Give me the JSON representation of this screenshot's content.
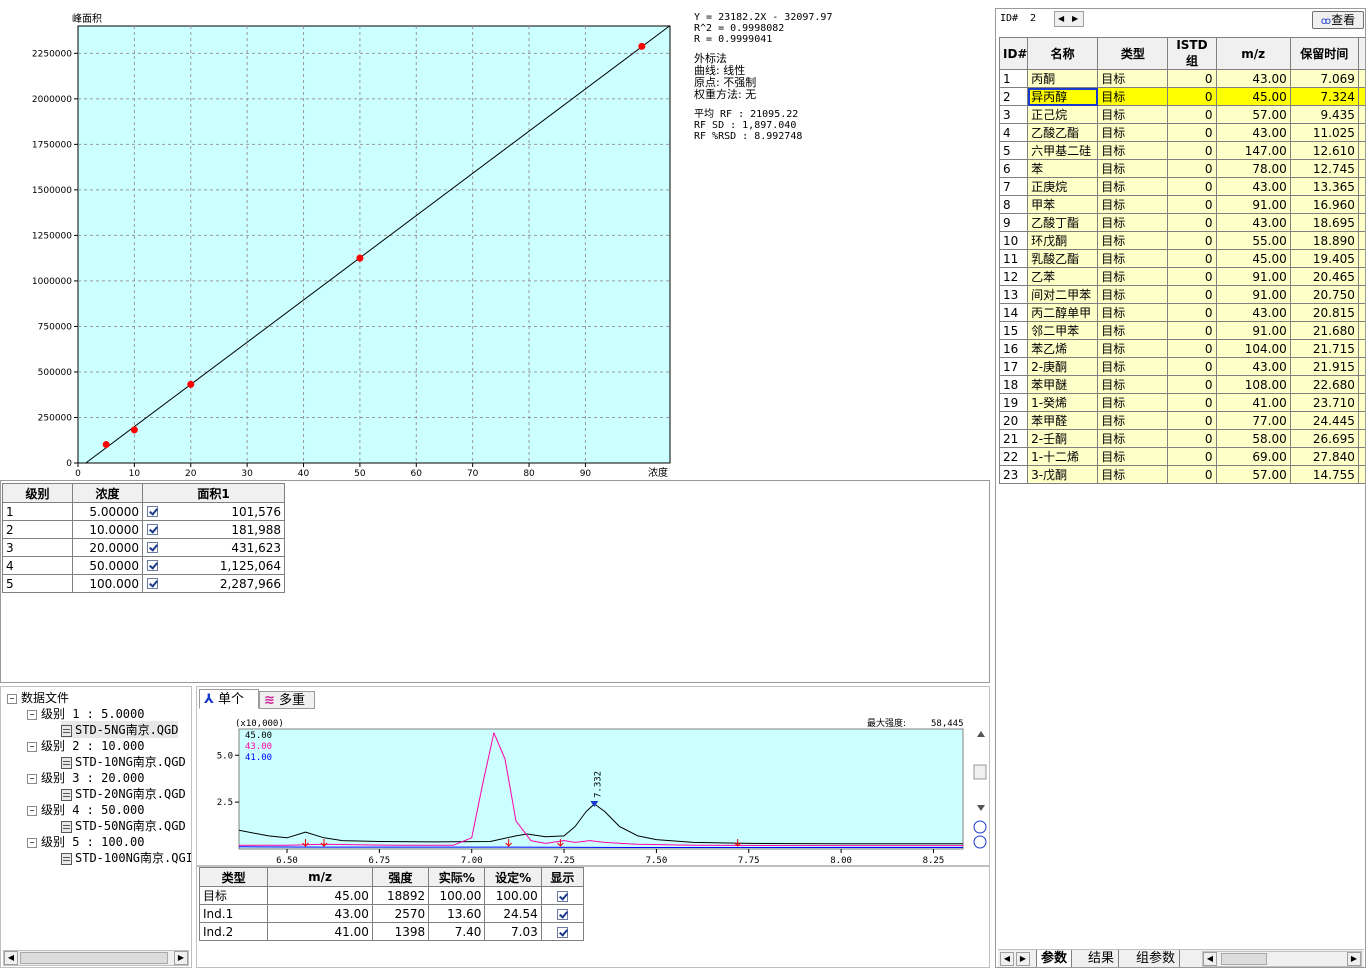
{
  "calibration": {
    "ylabel": "峰面积",
    "xlabel": "浓度",
    "equation_lines": [
      "Y = 23182.2X - 32097.97",
      "R^2 = 0.9998082",
      "R = 0.9999041"
    ],
    "method_lines": [
      "外标法",
      "曲线: 线性",
      "原点: 不强制",
      "权重方法: 无"
    ],
    "rf_lines": [
      "平均 RF :  21095.22",
      "RF SD : 1,897.040",
      "RF %RSD : 8.992748"
    ]
  },
  "chart_data": [
    {
      "type": "scatter",
      "title": "",
      "xlabel": "浓度",
      "ylabel": "峰面积",
      "xlim": [
        0,
        105
      ],
      "ylim": [
        0,
        2400000
      ],
      "x_ticks": [
        "0",
        "10",
        "20",
        "30",
        "40",
        "50",
        "60",
        "70",
        "80",
        "90"
      ],
      "x_tick_values": [
        0,
        10,
        20,
        30,
        40,
        50,
        60,
        70,
        80,
        90
      ],
      "y_ticks": [
        "0",
        "250000",
        "500000",
        "750000",
        "1000000",
        "1250000",
        "1500000",
        "1750000",
        "2000000",
        "2250000"
      ],
      "y_tick_values": [
        0,
        250000,
        500000,
        750000,
        1000000,
        1250000,
        1500000,
        1750000,
        2000000,
        2250000
      ],
      "grid": true,
      "points": [
        {
          "x": 5,
          "y": 101576
        },
        {
          "x": 10,
          "y": 181988
        },
        {
          "x": 20,
          "y": 431623
        },
        {
          "x": 50,
          "y": 1125064
        },
        {
          "x": 100,
          "y": 2287966
        }
      ],
      "fit_line": {
        "slope": 23182.2,
        "intercept": -32097.97
      },
      "colors": {
        "background": "#ccffff",
        "points": "#ff0000",
        "line": "#000000"
      }
    },
    {
      "type": "line",
      "title": "",
      "xlim": [
        6.37,
        8.33
      ],
      "ylim": [
        0,
        6.4
      ],
      "y_unit_label": "(x10,000)",
      "max_intensity_label": "最大强度:",
      "max_intensity_value": "58,445",
      "x_ticks": [
        "6.50",
        "6.75",
        "7.00",
        "7.25",
        "7.50",
        "7.75",
        "8.00",
        "8.25"
      ],
      "x_tick_values": [
        6.5,
        6.75,
        7.0,
        7.25,
        7.5,
        7.75,
        8.0,
        8.25
      ],
      "y_ticks": [
        "5.0",
        "2.5"
      ],
      "y_tick_values": [
        5.0,
        2.5
      ],
      "peak_label": "7.332",
      "peak_x": 7.332,
      "series": [
        {
          "name": "45.00",
          "color": "#000000",
          "x": [
            6.37,
            6.45,
            6.5,
            6.55,
            6.6,
            6.65,
            6.75,
            6.9,
            7.05,
            7.12,
            7.15,
            7.2,
            7.25,
            7.28,
            7.31,
            7.332,
            7.36,
            7.4,
            7.45,
            7.5,
            7.6,
            7.75,
            8.0,
            8.33
          ],
          "y": [
            1.0,
            0.7,
            0.6,
            0.9,
            0.6,
            0.45,
            0.4,
            0.38,
            0.4,
            0.7,
            0.8,
            0.65,
            0.7,
            1.2,
            2.0,
            2.4,
            2.0,
            1.2,
            0.7,
            0.5,
            0.35,
            0.3,
            0.28,
            0.28
          ]
        },
        {
          "name": "43.00",
          "color": "#ff00aa",
          "x": [
            6.37,
            6.5,
            6.6,
            6.8,
            6.95,
            7.0,
            7.03,
            7.06,
            7.09,
            7.12,
            7.16,
            7.2,
            7.25,
            7.28,
            7.32,
            7.36,
            7.45,
            7.6,
            8.0,
            8.33
          ],
          "y": [
            0.2,
            0.2,
            0.25,
            0.2,
            0.2,
            0.6,
            3.5,
            6.2,
            4.8,
            1.5,
            0.45,
            0.3,
            0.45,
            0.35,
            0.45,
            0.35,
            0.25,
            0.2,
            0.18,
            0.18
          ]
        },
        {
          "name": "41.00",
          "color": "#0000ff",
          "x": [
            6.37,
            6.6,
            7.0,
            7.5,
            8.0,
            8.33
          ],
          "y": [
            0.12,
            0.1,
            0.1,
            0.08,
            0.08,
            0.08
          ]
        }
      ],
      "integration_marks_x": [
        6.55,
        6.6,
        7.1,
        7.24,
        7.72
      ]
    }
  ],
  "levels_table": {
    "headers": [
      "级别",
      "浓度",
      "面积1"
    ],
    "rows": [
      [
        "1",
        "5.00000",
        "101,576"
      ],
      [
        "2",
        "10.0000",
        "181,988"
      ],
      [
        "3",
        "20.0000",
        "431,623"
      ],
      [
        "4",
        "50.0000",
        "1,125,064"
      ],
      [
        "5",
        "100.000",
        "2,287,966"
      ]
    ]
  },
  "tree": {
    "root": "数据文件",
    "levels": [
      {
        "label": "级别 1 : 5.0000",
        "file": "STD-5NG南京.QGD"
      },
      {
        "label": "级别 2 : 10.000",
        "file": "STD-10NG南京.QGD"
      },
      {
        "label": "级别 3 : 20.000",
        "file": "STD-20NG南京.QGD"
      },
      {
        "label": "级别 4 : 50.000",
        "file": "STD-50NG南京.QGD"
      },
      {
        "label": "级别 5 : 100.00",
        "file": "STD-100NG南京.QGI"
      }
    ]
  },
  "chrom_tabs": [
    "单个",
    "多重"
  ],
  "ion_table": {
    "headers": [
      "类型",
      "m/z",
      "强度",
      "实际%",
      "设定%",
      "显示"
    ],
    "rows": [
      [
        "目标",
        "45.00",
        "18892",
        "100.00",
        "100.00"
      ],
      [
        "Ind.1",
        "43.00",
        "2570",
        "13.60",
        "24.54"
      ],
      [
        "Ind.2",
        "41.00",
        "1398",
        "7.40",
        "7.03"
      ]
    ]
  },
  "right_panel": {
    "id_label": "ID#",
    "id_value": "2",
    "view_button": "查看",
    "headers": [
      "ID#",
      "名称",
      "类型",
      "ISTD 组",
      "m/z",
      "保留时间"
    ],
    "rows": [
      [
        "1",
        "丙酮",
        "目标",
        "0",
        "43.00",
        "7.069"
      ],
      [
        "2",
        "异丙醇",
        "目标",
        "0",
        "45.00",
        "7.324"
      ],
      [
        "3",
        "正己烷",
        "目标",
        "0",
        "57.00",
        "9.435"
      ],
      [
        "4",
        "乙酸乙酯",
        "目标",
        "0",
        "43.00",
        "11.025"
      ],
      [
        "5",
        "六甲基二硅",
        "目标",
        "0",
        "147.00",
        "12.610"
      ],
      [
        "6",
        "苯",
        "目标",
        "0",
        "78.00",
        "12.745"
      ],
      [
        "7",
        "正庚烷",
        "目标",
        "0",
        "43.00",
        "13.365"
      ],
      [
        "8",
        "甲苯",
        "目标",
        "0",
        "91.00",
        "16.960"
      ],
      [
        "9",
        "乙酸丁酯",
        "目标",
        "0",
        "43.00",
        "18.695"
      ],
      [
        "10",
        "环戊酮",
        "目标",
        "0",
        "55.00",
        "18.890"
      ],
      [
        "11",
        "乳酸乙酯",
        "目标",
        "0",
        "45.00",
        "19.405"
      ],
      [
        "12",
        "乙苯",
        "目标",
        "0",
        "91.00",
        "20.465"
      ],
      [
        "13",
        "间对二甲苯",
        "目标",
        "0",
        "91.00",
        "20.750"
      ],
      [
        "14",
        "丙二醇单甲",
        "目标",
        "0",
        "43.00",
        "20.815"
      ],
      [
        "15",
        "邻二甲苯",
        "目标",
        "0",
        "91.00",
        "21.680"
      ],
      [
        "16",
        "苯乙烯",
        "目标",
        "0",
        "104.00",
        "21.715"
      ],
      [
        "17",
        "2-庚酮",
        "目标",
        "0",
        "43.00",
        "21.915"
      ],
      [
        "18",
        "苯甲醚",
        "目标",
        "0",
        "108.00",
        "22.680"
      ],
      [
        "19",
        "1-癸烯",
        "目标",
        "0",
        "41.00",
        "23.710"
      ],
      [
        "20",
        "苯甲醛",
        "目标",
        "0",
        "77.00",
        "24.445"
      ],
      [
        "21",
        "2-壬酮",
        "目标",
        "0",
        "58.00",
        "26.695"
      ],
      [
        "22",
        "1-十二烯",
        "目标",
        "0",
        "69.00",
        "27.840"
      ],
      [
        "23",
        "3-戊酮",
        "目标",
        "0",
        "57.00",
        "14.755"
      ]
    ],
    "bottom_tabs": [
      "参数",
      "结果",
      "组参数"
    ]
  }
}
